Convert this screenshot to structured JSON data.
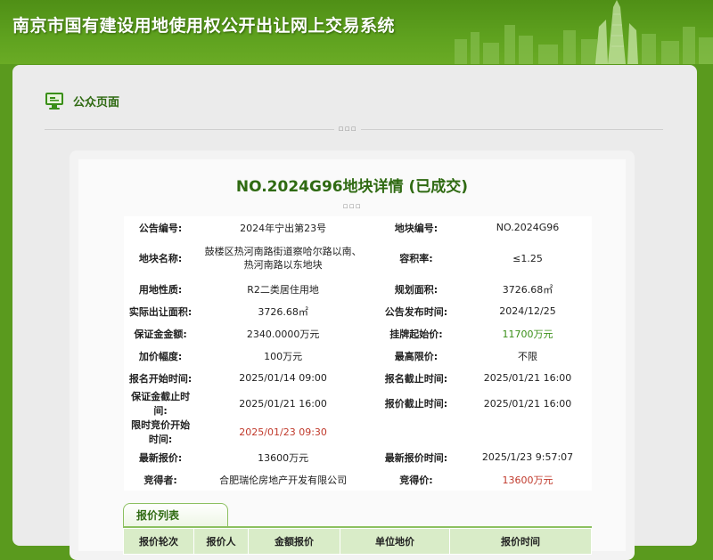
{
  "header": {
    "title": "南京市国有建设用地使用权公开出让网上交易系统"
  },
  "section": {
    "title": "公众页面",
    "icon": "monitor-icon"
  },
  "detail": {
    "title": "NO.2024G96地块详情 (已成交)"
  },
  "info_rows": [
    {
      "l1": "公告编号:",
      "v1": "2024年宁出第23号",
      "l2": "地块编号:",
      "v2": "NO.2024G96"
    },
    {
      "l1": "地块名称:",
      "v1": "鼓楼区热河南路街道察哈尔路以南、热河南路以东地块",
      "l2": "容积率:",
      "v2": "≤1.25"
    },
    {
      "l1": "用地性质:",
      "v1": "R2二类居住用地",
      "l2": "规划面积:",
      "v2": "3726.68㎡"
    },
    {
      "l1": "实际出让面积:",
      "v1": "3726.68㎡",
      "l2": "公告发布时间:",
      "v2": "2024/12/25"
    },
    {
      "l1": "保证金金额:",
      "v1": "2340.0000万元",
      "l2": "挂牌起始价:",
      "v2": "11700万元"
    },
    {
      "l1": "加价幅度:",
      "v1": "100万元",
      "l2": "最高限价:",
      "v2": "不限"
    },
    {
      "l1": "报名开始时间:",
      "v1": "2025/01/14 09:00",
      "l2": "报名截止时间:",
      "v2": "2025/01/21 16:00"
    },
    {
      "l1": "保证金截止时间:",
      "v1": "2025/01/21 16:00",
      "l2": "报价截止时间:",
      "v2": "2025/01/21 16:00"
    },
    {
      "l1": "限时竞价开始时间:",
      "v1": "2025/01/23 09:30",
      "l2": "",
      "v2": ""
    },
    {
      "l1": "最新报价:",
      "v1": "13600万元",
      "l2": "最新报价时间:",
      "v2": "2025/1/23 9:57:07"
    },
    {
      "l1": "竞得者:",
      "v1": "合肥瑞伦房地产开发有限公司",
      "l2": "竞得价:",
      "v2": "13600万元"
    }
  ],
  "bid_list": {
    "tab_label": "报价列表",
    "columns": [
      "报价轮次",
      "报价人",
      "金额报价",
      "单位地价",
      "报价时间"
    ]
  },
  "colors": {
    "brand_green": "#5a9a1e",
    "price_green": "#3a8f18",
    "price_red": "#c0392b"
  }
}
